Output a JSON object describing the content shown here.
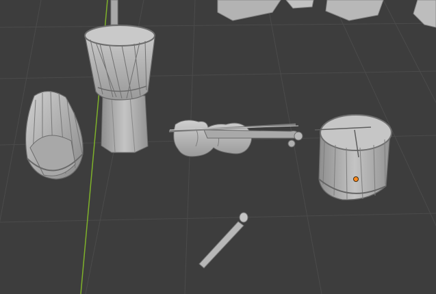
{
  "viewport": {
    "background_color": "#3d3d3d",
    "grid_color": "#4b4b4b",
    "y_axis_color": "#7fb22a",
    "mesh_color": "#b9b9b9",
    "mesh_shadow_color": "#7f7f7f",
    "mesh_edge_color": "#5c5c5c",
    "origin_color": "#ff8a1f"
  },
  "scene_objects": [
    {
      "name": "djembe",
      "type": "mesh"
    },
    {
      "name": "bongo-tilted",
      "type": "mesh"
    },
    {
      "name": "violin",
      "type": "mesh"
    },
    {
      "name": "snare-drum",
      "type": "mesh",
      "selected_origin": true
    },
    {
      "name": "drumstick",
      "type": "mesh"
    },
    {
      "name": "background-block-1",
      "type": "mesh"
    },
    {
      "name": "background-block-2",
      "type": "mesh"
    },
    {
      "name": "background-block-3",
      "type": "mesh"
    },
    {
      "name": "background-block-4",
      "type": "mesh"
    }
  ]
}
